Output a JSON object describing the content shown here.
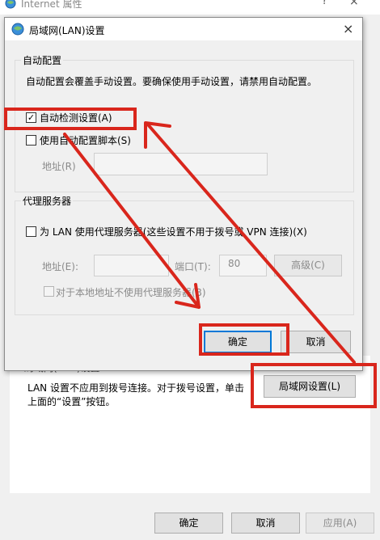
{
  "parent_window": {
    "title": "Internet 属性",
    "help_glyph": "?",
    "close_glyph": "×",
    "lan_section_title": "局域网(LAN)设置",
    "lan_description": "LAN 设置不应用到拨号连接。对于拨号设置，单击上面的“设置”按钮。",
    "lan_settings_button": "局域网设置(L)",
    "ok_button": "确定",
    "cancel_button": "取消",
    "apply_button": "应用(A)"
  },
  "lan_dialog": {
    "title": "局域网(LAN)设置",
    "close_glyph": "×",
    "auto_config": {
      "group_label": "自动配置",
      "description": "自动配置会覆盖手动设置。要确保使用手动设置，请禁用自动配置。",
      "auto_detect_label": "自动检测设置(A)",
      "auto_detect_checked": true,
      "use_script_label": "使用自动配置脚本(S)",
      "use_script_checked": false,
      "address_label": "地址(R)",
      "address_value": ""
    },
    "proxy": {
      "group_label": "代理服务器",
      "use_proxy_label": "为 LAN 使用代理服务器(这些设置不用于拨号或 VPN 连接)(X)",
      "use_proxy_checked": false,
      "address_label": "地址(E):",
      "address_value": "",
      "port_label": "端口(T):",
      "port_value": "80",
      "advanced_button": "高级(C)",
      "bypass_local_label": "对于本地地址不使用代理服务器(B)",
      "bypass_local_checked": false
    },
    "ok_button": "确定",
    "cancel_button": "取消",
    "check_glyph": "✓"
  },
  "annotation_color": "#d9261c"
}
